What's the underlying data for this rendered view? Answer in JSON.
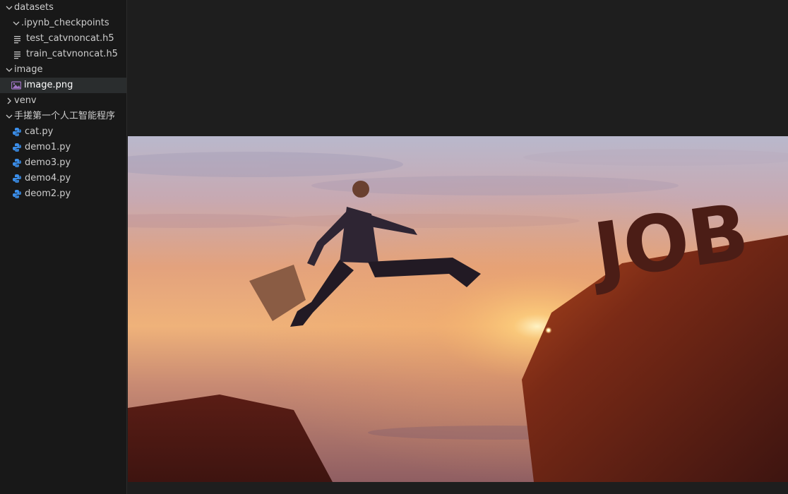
{
  "explorer": {
    "items": [
      {
        "label": "datasets",
        "type": "folder",
        "expanded": true,
        "depth": 0
      },
      {
        "label": ".ipynb_checkpoints",
        "type": "folder",
        "expanded": true,
        "depth": 1
      },
      {
        "label": "test_catvnoncat.h5",
        "type": "file-text",
        "depth": 1
      },
      {
        "label": "train_catvnoncat.h5",
        "type": "file-text",
        "depth": 1
      },
      {
        "label": "image",
        "type": "folder",
        "expanded": true,
        "depth": 0
      },
      {
        "label": "image.png",
        "type": "file-image",
        "depth": 1,
        "selected": true
      },
      {
        "label": "venv",
        "type": "folder",
        "expanded": false,
        "depth": 0
      },
      {
        "label": "手搓第一个人工智能程序",
        "type": "folder",
        "expanded": true,
        "depth": 0
      },
      {
        "label": "cat.py",
        "type": "file-python",
        "depth": 1
      },
      {
        "label": "demo1.py",
        "type": "file-python",
        "depth": 1
      },
      {
        "label": "demo3.py",
        "type": "file-python",
        "depth": 1
      },
      {
        "label": "demo4.py",
        "type": "file-python",
        "depth": 1
      },
      {
        "label": "deom2.py",
        "type": "file-python",
        "depth": 1
      }
    ]
  },
  "preview": {
    "image_text": "JOB"
  },
  "colors": {
    "sidebar_bg": "#181818",
    "editor_bg": "#1e1e1e",
    "selected_row": "#2a2d2e",
    "python_icon": "#3b8eea",
    "image_icon": "#a074c4"
  }
}
